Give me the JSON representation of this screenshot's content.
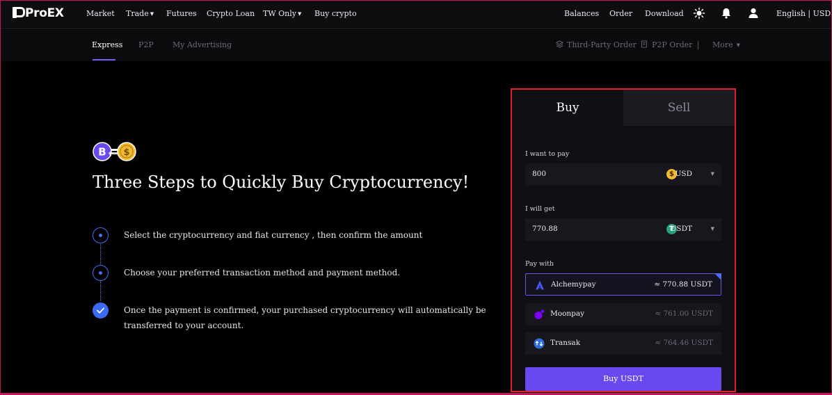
{
  "brand": {
    "name": "ProEX"
  },
  "topnav": {
    "items": [
      {
        "label": "Market"
      },
      {
        "label": "Trade",
        "dropdown": true
      },
      {
        "label": "Futures"
      },
      {
        "label": "Crypto Loan"
      },
      {
        "label": "TW Only",
        "dropdown": true
      },
      {
        "label": "Buy crypto"
      }
    ],
    "right": {
      "balances": "Balances",
      "order": "Order",
      "download": "Download",
      "language": "English | USD"
    }
  },
  "subnav": {
    "tabs": [
      "Express",
      "P2P",
      "My Advertising"
    ],
    "active_tab": "Express",
    "third_party_order": "Third-Party Order",
    "p2p_order": "P2P Order",
    "more": "More"
  },
  "hero": {
    "title": "Three Steps to Quickly Buy Cryptocurrency!",
    "steps": [
      "Select the cryptocurrency and fiat currency , then confirm the amount",
      "Choose your preferred transaction method and payment method.",
      "Once the payment is confirmed, your purchased cryptocurrency will automatically be transferred to your account."
    ]
  },
  "trade_panel": {
    "tabs": {
      "buy": "Buy",
      "sell": "Sell"
    },
    "active_tab": "Buy",
    "pay_label": "I want to pay",
    "pay_amount": "800",
    "pay_currency": "USD",
    "get_label": "I will get",
    "get_amount": "770.88",
    "get_currency": "USDT",
    "pay_with_label": "Pay with",
    "providers": [
      {
        "name": "Alchemypay",
        "quote": "≈ 770.88 USDT",
        "selected": true
      },
      {
        "name": "Moonpay",
        "quote": "≈ 761.00 USDT",
        "selected": false
      },
      {
        "name": "Transak",
        "quote": "≈ 764.46 USDT",
        "selected": false
      }
    ],
    "submit_label": "Buy USDT"
  },
  "colors": {
    "accent": "#6a48f0",
    "step_blue": "#4a6cf7",
    "highlight_border": "#e0202a",
    "usd_coin": "#f3ba2f",
    "usdt_coin": "#26a17b"
  }
}
